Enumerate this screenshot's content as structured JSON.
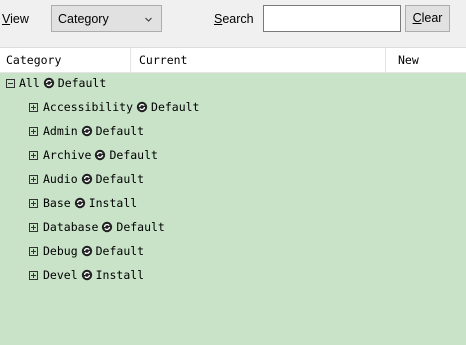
{
  "toolbar": {
    "view_label": "View",
    "view_value": "Category",
    "search_label": "Search",
    "search_value": "",
    "clear_label": "Clear"
  },
  "columns": [
    "Category",
    "Current",
    "New"
  ],
  "tree": {
    "root": {
      "name": "All",
      "state": "Default",
      "expanded": true
    },
    "items": [
      {
        "name": "Accessibility",
        "state": "Default",
        "expanded": false
      },
      {
        "name": "Admin",
        "state": "Default",
        "expanded": false
      },
      {
        "name": "Archive",
        "state": "Default",
        "expanded": false
      },
      {
        "name": "Audio",
        "state": "Default",
        "expanded": false
      },
      {
        "name": "Base",
        "state": "Install",
        "expanded": false
      },
      {
        "name": "Database",
        "state": "Default",
        "expanded": false
      },
      {
        "name": "Debug",
        "state": "Default",
        "expanded": false
      },
      {
        "name": "Devel",
        "state": "Install",
        "expanded": false
      }
    ]
  },
  "colors": {
    "tree_bg": "#c9e3c9",
    "toolbar_bg": "#f0f0f0"
  },
  "icons": {
    "expand": "plus-box-icon",
    "collapse": "minus-box-icon",
    "state": "cycle-arrows-icon"
  }
}
